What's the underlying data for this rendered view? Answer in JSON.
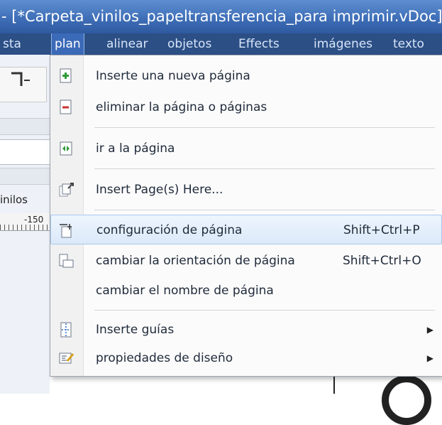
{
  "window": {
    "title": "- [*Carpeta_vinilos_papeltransferencia_para imprimir.vDoc]"
  },
  "menubar": {
    "items": [
      {
        "label": "sta",
        "active": false
      },
      {
        "label": "plan",
        "active": true
      },
      {
        "label": "alinear",
        "active": false
      },
      {
        "label": "objetos",
        "active": false
      },
      {
        "label": "Effects",
        "active": false
      },
      {
        "label": "imágenes",
        "active": false
      },
      {
        "label": "texto",
        "active": false
      }
    ]
  },
  "background": {
    "tab_label": "inilos",
    "ruler_number": "-150"
  },
  "dropdown": {
    "items": [
      {
        "label": "Inserte una nueva página",
        "shortcut": "",
        "icon": "insert-page-icon"
      },
      {
        "label": "eliminar la página o páginas",
        "shortcut": "",
        "icon": "delete-page-icon"
      },
      {
        "label": "ir a la página",
        "shortcut": "",
        "icon": "goto-page-icon"
      },
      {
        "label": "Insert Page(s) Here...",
        "shortcut": "",
        "icon": "insert-pages-here-icon"
      },
      {
        "label": "configuración de página",
        "shortcut": "Shift+Ctrl+P",
        "icon": "page-setup-icon",
        "highlighted": true
      },
      {
        "label": "cambiar la orientación de página",
        "shortcut": "Shift+Ctrl+O",
        "icon": "orientation-icon"
      },
      {
        "label": "cambiar el nombre de página",
        "shortcut": "",
        "icon": ""
      },
      {
        "label": "Inserte guías",
        "shortcut": "",
        "icon": "guides-icon",
        "submenu": true
      },
      {
        "label": "propiedades de diseño",
        "shortcut": "",
        "icon": "layout-properties-icon",
        "submenu": true
      }
    ]
  },
  "colors": {
    "titlebar": "#3f6fb8",
    "menubar": "#2c4f86",
    "highlight": "#dbe9f9",
    "icon_green": "#2e9a3a",
    "icon_red": "#c83232"
  }
}
